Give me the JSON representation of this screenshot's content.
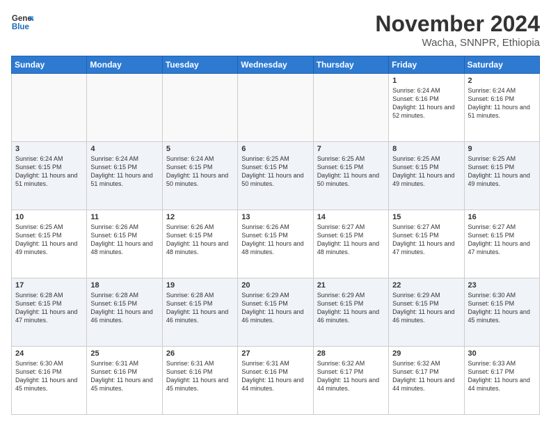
{
  "logo": {
    "line1": "General",
    "line2": "Blue"
  },
  "header": {
    "month": "November 2024",
    "location": "Wacha, SNNPR, Ethiopia"
  },
  "days_of_week": [
    "Sunday",
    "Monday",
    "Tuesday",
    "Wednesday",
    "Thursday",
    "Friday",
    "Saturday"
  ],
  "weeks": [
    [
      {
        "day": "",
        "info": ""
      },
      {
        "day": "",
        "info": ""
      },
      {
        "day": "",
        "info": ""
      },
      {
        "day": "",
        "info": ""
      },
      {
        "day": "",
        "info": ""
      },
      {
        "day": "1",
        "info": "Sunrise: 6:24 AM\nSunset: 6:16 PM\nDaylight: 11 hours and 52 minutes."
      },
      {
        "day": "2",
        "info": "Sunrise: 6:24 AM\nSunset: 6:16 PM\nDaylight: 11 hours and 51 minutes."
      }
    ],
    [
      {
        "day": "3",
        "info": "Sunrise: 6:24 AM\nSunset: 6:15 PM\nDaylight: 11 hours and 51 minutes."
      },
      {
        "day": "4",
        "info": "Sunrise: 6:24 AM\nSunset: 6:15 PM\nDaylight: 11 hours and 51 minutes."
      },
      {
        "day": "5",
        "info": "Sunrise: 6:24 AM\nSunset: 6:15 PM\nDaylight: 11 hours and 50 minutes."
      },
      {
        "day": "6",
        "info": "Sunrise: 6:25 AM\nSunset: 6:15 PM\nDaylight: 11 hours and 50 minutes."
      },
      {
        "day": "7",
        "info": "Sunrise: 6:25 AM\nSunset: 6:15 PM\nDaylight: 11 hours and 50 minutes."
      },
      {
        "day": "8",
        "info": "Sunrise: 6:25 AM\nSunset: 6:15 PM\nDaylight: 11 hours and 49 minutes."
      },
      {
        "day": "9",
        "info": "Sunrise: 6:25 AM\nSunset: 6:15 PM\nDaylight: 11 hours and 49 minutes."
      }
    ],
    [
      {
        "day": "10",
        "info": "Sunrise: 6:25 AM\nSunset: 6:15 PM\nDaylight: 11 hours and 49 minutes."
      },
      {
        "day": "11",
        "info": "Sunrise: 6:26 AM\nSunset: 6:15 PM\nDaylight: 11 hours and 48 minutes."
      },
      {
        "day": "12",
        "info": "Sunrise: 6:26 AM\nSunset: 6:15 PM\nDaylight: 11 hours and 48 minutes."
      },
      {
        "day": "13",
        "info": "Sunrise: 6:26 AM\nSunset: 6:15 PM\nDaylight: 11 hours and 48 minutes."
      },
      {
        "day": "14",
        "info": "Sunrise: 6:27 AM\nSunset: 6:15 PM\nDaylight: 11 hours and 48 minutes."
      },
      {
        "day": "15",
        "info": "Sunrise: 6:27 AM\nSunset: 6:15 PM\nDaylight: 11 hours and 47 minutes."
      },
      {
        "day": "16",
        "info": "Sunrise: 6:27 AM\nSunset: 6:15 PM\nDaylight: 11 hours and 47 minutes."
      }
    ],
    [
      {
        "day": "17",
        "info": "Sunrise: 6:28 AM\nSunset: 6:15 PM\nDaylight: 11 hours and 47 minutes."
      },
      {
        "day": "18",
        "info": "Sunrise: 6:28 AM\nSunset: 6:15 PM\nDaylight: 11 hours and 46 minutes."
      },
      {
        "day": "19",
        "info": "Sunrise: 6:28 AM\nSunset: 6:15 PM\nDaylight: 11 hours and 46 minutes."
      },
      {
        "day": "20",
        "info": "Sunrise: 6:29 AM\nSunset: 6:15 PM\nDaylight: 11 hours and 46 minutes."
      },
      {
        "day": "21",
        "info": "Sunrise: 6:29 AM\nSunset: 6:15 PM\nDaylight: 11 hours and 46 minutes."
      },
      {
        "day": "22",
        "info": "Sunrise: 6:29 AM\nSunset: 6:15 PM\nDaylight: 11 hours and 46 minutes."
      },
      {
        "day": "23",
        "info": "Sunrise: 6:30 AM\nSunset: 6:15 PM\nDaylight: 11 hours and 45 minutes."
      }
    ],
    [
      {
        "day": "24",
        "info": "Sunrise: 6:30 AM\nSunset: 6:16 PM\nDaylight: 11 hours and 45 minutes."
      },
      {
        "day": "25",
        "info": "Sunrise: 6:31 AM\nSunset: 6:16 PM\nDaylight: 11 hours and 45 minutes."
      },
      {
        "day": "26",
        "info": "Sunrise: 6:31 AM\nSunset: 6:16 PM\nDaylight: 11 hours and 45 minutes."
      },
      {
        "day": "27",
        "info": "Sunrise: 6:31 AM\nSunset: 6:16 PM\nDaylight: 11 hours and 44 minutes."
      },
      {
        "day": "28",
        "info": "Sunrise: 6:32 AM\nSunset: 6:17 PM\nDaylight: 11 hours and 44 minutes."
      },
      {
        "day": "29",
        "info": "Sunrise: 6:32 AM\nSunset: 6:17 PM\nDaylight: 11 hours and 44 minutes."
      },
      {
        "day": "30",
        "info": "Sunrise: 6:33 AM\nSunset: 6:17 PM\nDaylight: 11 hours and 44 minutes."
      }
    ]
  ]
}
